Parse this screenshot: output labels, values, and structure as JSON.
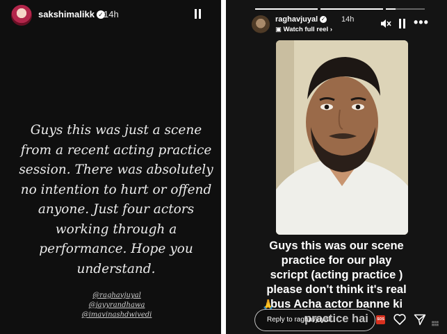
{
  "left_story": {
    "username": "sakshimalikk",
    "time": "14h",
    "statement": "Guys this was just a scene\nfrom a recent acting practice\nsession. There was absolutely\nno intention to hurt or offend\nanyone. Just four actors\nworking through a\nperformance. Hope you\nunderstand.",
    "tags": [
      "@raghavjuyal",
      "@jayyrandhawa",
      "@imavinashdwivedi"
    ]
  },
  "right_story": {
    "username": "raghavjuyal",
    "time": "14h",
    "watch_label": "Watch full reel",
    "caption": "Guys this was our scene\npractice for our play\nscricpt (acting practice )\nplease don't think it's real\nbus Acha actor banne ki\npractice hai",
    "reply_placeholder": "Reply to raghavjuyal...",
    "icons": [
      "audio-muted-icon",
      "pause-icon",
      "more-options-icon",
      "heart-icon",
      "send-icon",
      "folded-hands-emoji"
    ]
  },
  "colors": {
    "left_bg": "#0f0f0f",
    "right_bg": "#141414",
    "sos_red": "#d9311f"
  }
}
